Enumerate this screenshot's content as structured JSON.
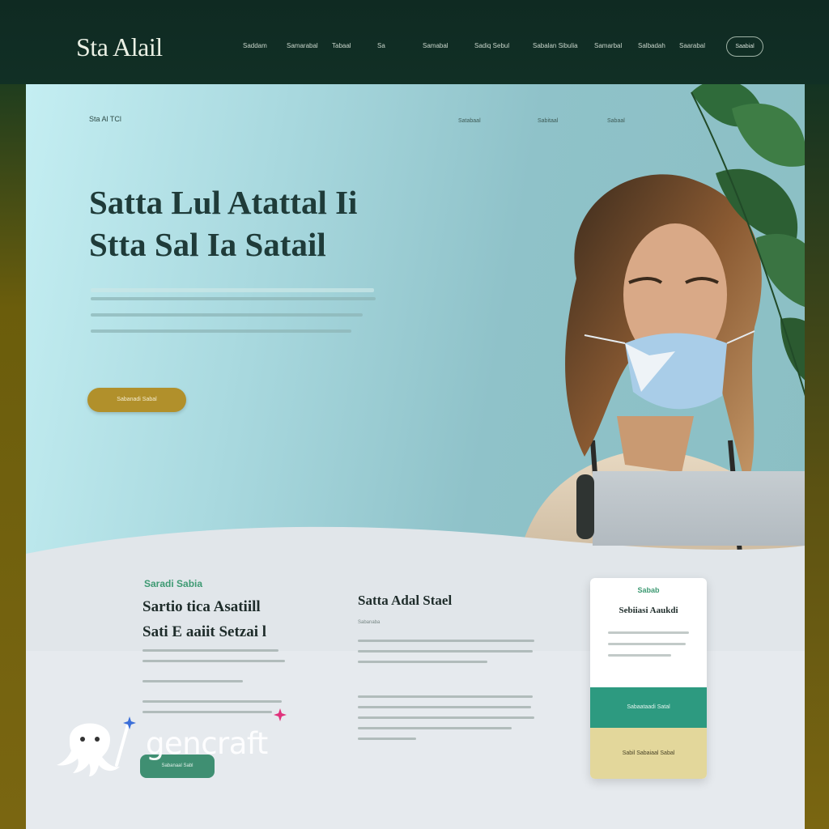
{
  "brand": {
    "logo_text": "Sta Alail"
  },
  "nav": {
    "items": [
      "Saddam",
      "Samarabal",
      "Tabaal",
      "Sa",
      "Samabal",
      "Sadiq Sebul",
      "Sabalan Sibulia",
      "Samarbal",
      "Salbadah",
      "Saarabal"
    ],
    "cta_label": "Saabial"
  },
  "hero": {
    "kicker": "Sta Al TCl",
    "links": [
      "Satabaal",
      "Sabitaal",
      "Sabaal"
    ],
    "title_line1": "Satta Lul Atattal Ii",
    "title_line2": "Stta Sal Ia Satail",
    "cta_label": "Sabanadi Sabal"
  },
  "section_left": {
    "kicker": "Saradi Sabia",
    "title_line1": "Sartio tica Asatiill",
    "title_line2": "Sati E aaiit Setzai l",
    "button_label": "Sabanaal Sabl"
  },
  "section_middle": {
    "title": "Satta Adal Stael",
    "subtitle": "Sabanaba"
  },
  "pricing_card": {
    "tag": "Sabab",
    "title": "Sebiiasi Aaukdi",
    "band_label": "Sabaataadi Satal",
    "bottom_label": "Sabil Sabaiaal Sabal"
  },
  "watermark": {
    "text": "gencraft"
  },
  "colors": {
    "accent_green": "#3e9a73",
    "hero_button": "#b1902b",
    "band_teal": "#2d9a80",
    "card_cream": "#e3d79b",
    "frame_dark": "#0f2a22"
  },
  "icons": [
    "leaf-decoration-icon",
    "octopus-logo-icon",
    "magic-wand-icon"
  ]
}
